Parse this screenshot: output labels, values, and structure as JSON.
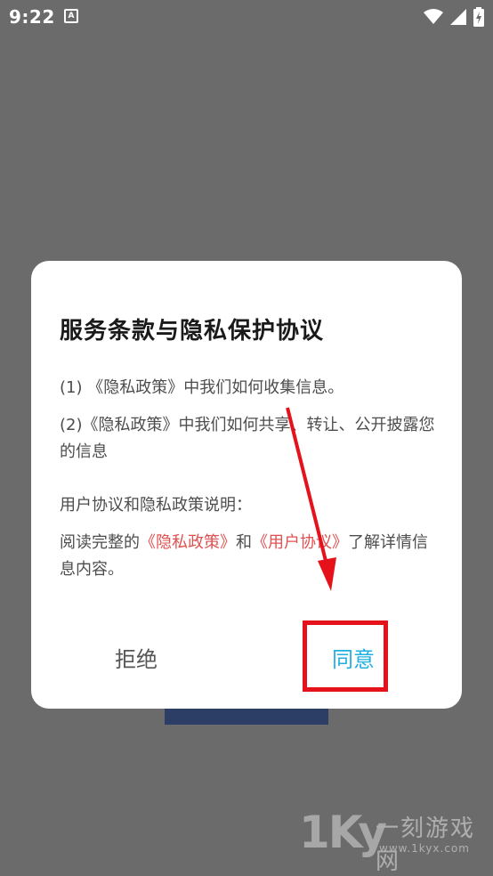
{
  "status_bar": {
    "time": "9:22",
    "notification_icon_letter": "A"
  },
  "dialog": {
    "title": "服务条款与隐私保护协议",
    "item1": "(1) 《隐私政策》中我们如何收集信息。",
    "item2": "(2)《隐私政策》中我们如何共享、转让、公开披露您的信息",
    "section_label": "用户协议和隐私政策说明：",
    "read_prefix": "阅读完整的",
    "privacy_link": "《隐私政策》",
    "and_text": "和",
    "user_agreement_link": "《用户协议》",
    "read_suffix": "了解详情信息内容。",
    "refuse_label": "拒绝",
    "agree_label": "同意"
  },
  "watermark": {
    "logo": "1Ky",
    "name": "一刻游戏网",
    "url": "www.1kyx.com"
  },
  "colors": {
    "link": "#e0504f",
    "agree": "#20b0e0",
    "annotation": "#e5121c",
    "overlay": "#6b6b6b"
  }
}
